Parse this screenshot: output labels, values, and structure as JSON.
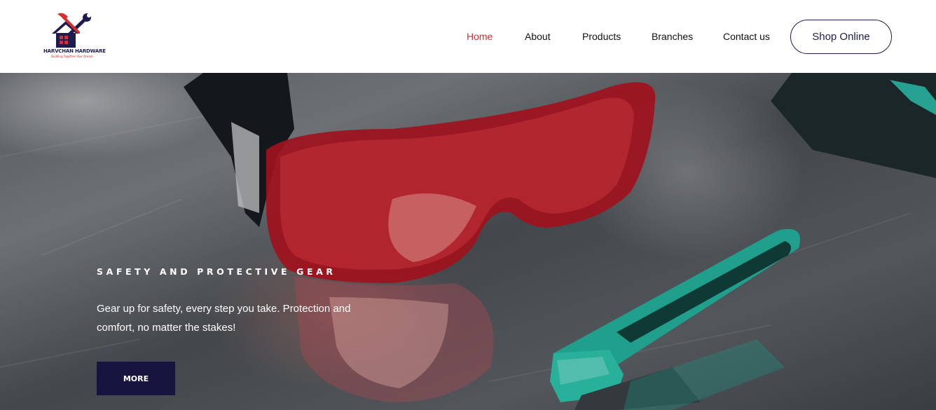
{
  "brand": {
    "name": "HARVCHAN HARDWARE",
    "tagline": "Building Together Your Dream"
  },
  "nav": {
    "items": [
      {
        "label": "Home",
        "active": true
      },
      {
        "label": "About",
        "active": false
      },
      {
        "label": "Products",
        "active": false
      },
      {
        "label": "Branches",
        "active": false
      },
      {
        "label": "Contact us",
        "active": false
      }
    ],
    "shop_label": "Shop Online"
  },
  "hero": {
    "heading": "SAFETY AND PROTECTIVE GEAR",
    "text": "Gear up for safety, every step you take. Protection and comfort, no matter the stakes!",
    "button_label": "MORE"
  },
  "colors": {
    "accent_red": "#d32f2f",
    "brand_navy": "#15153f"
  }
}
